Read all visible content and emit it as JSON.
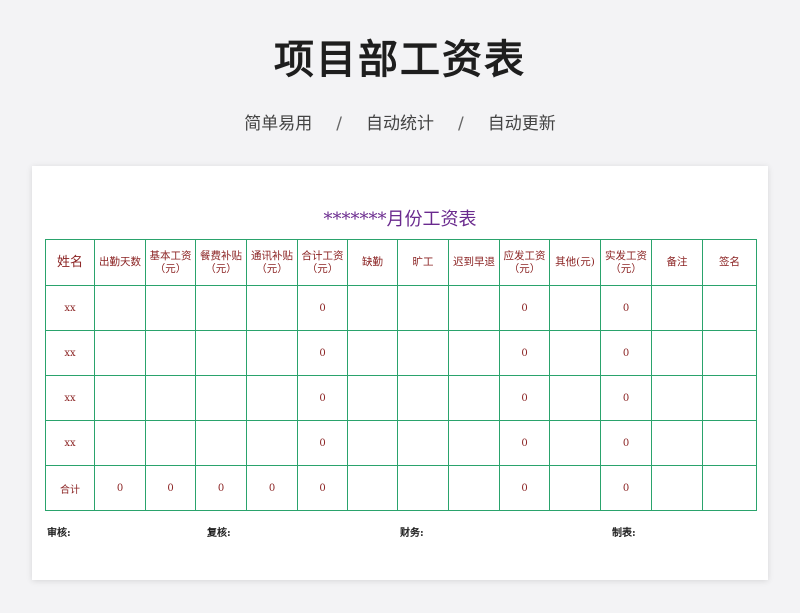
{
  "hero": {
    "title": "项目部工资表",
    "features": [
      "简单易用",
      "自动统计",
      "自动更新"
    ],
    "separator": "/"
  },
  "sheet": {
    "title": "*******月份工资表",
    "headers": [
      "姓名",
      "出勤天数",
      "基本工资（元）",
      "餐费补贴（元）",
      "通讯补贴（元）",
      "合计工资（元）",
      "缺勤",
      "旷工",
      "迟到早退",
      "应发工资（元）",
      "其他(元)",
      "实发工资（元）",
      "备注",
      "签名"
    ],
    "rows": [
      [
        "xx",
        "",
        "",
        "",
        "",
        "0",
        "",
        "",
        "",
        "0",
        "",
        "0",
        "",
        ""
      ],
      [
        "xx",
        "",
        "",
        "",
        "",
        "0",
        "",
        "",
        "",
        "0",
        "",
        "0",
        "",
        ""
      ],
      [
        "xx",
        "",
        "",
        "",
        "",
        "0",
        "",
        "",
        "",
        "0",
        "",
        "0",
        "",
        ""
      ],
      [
        "xx",
        "",
        "",
        "",
        "",
        "0",
        "",
        "",
        "",
        "0",
        "",
        "0",
        "",
        ""
      ],
      [
        "合计",
        "0",
        "0",
        "0",
        "0",
        "0",
        "",
        "",
        "",
        "0",
        "",
        "0",
        "",
        ""
      ]
    ],
    "footer": {
      "review": "审核:",
      "recheck": "复核:",
      "finance": "财务:",
      "prepared_by": "制表:"
    }
  },
  "colors": {
    "grid": "#2aa36c",
    "cell_text": "#8b2323",
    "sheet_title": "#6a2a8e"
  }
}
